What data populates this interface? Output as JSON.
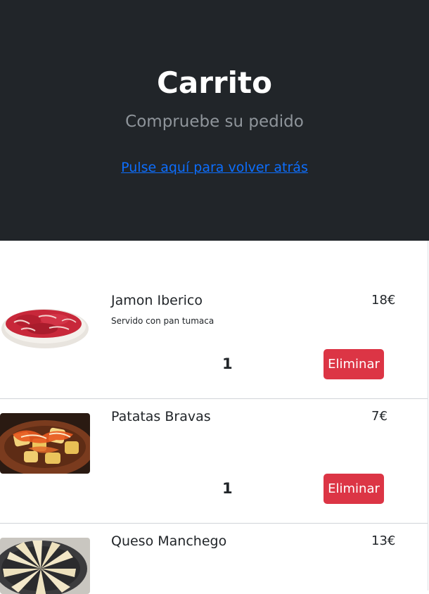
{
  "header": {
    "title": "Carrito",
    "subtitle": "Compruebe su pedido",
    "back_link": "Pulse aquí para volver atrás"
  },
  "cart": {
    "items": [
      {
        "name": "Jamon Iberico",
        "description": "Servido con pan tumaca",
        "price": "18€",
        "quantity": "1",
        "remove_label": "Eliminar"
      },
      {
        "name": "Patatas Bravas",
        "description": "",
        "price": "7€",
        "quantity": "1",
        "remove_label": "Eliminar"
      },
      {
        "name": "Queso Manchego",
        "description": "",
        "price": "13€"
      }
    ]
  },
  "colors": {
    "header_bg": "#212529",
    "link": "#0d6efd",
    "remove_button": "#dc3545"
  }
}
